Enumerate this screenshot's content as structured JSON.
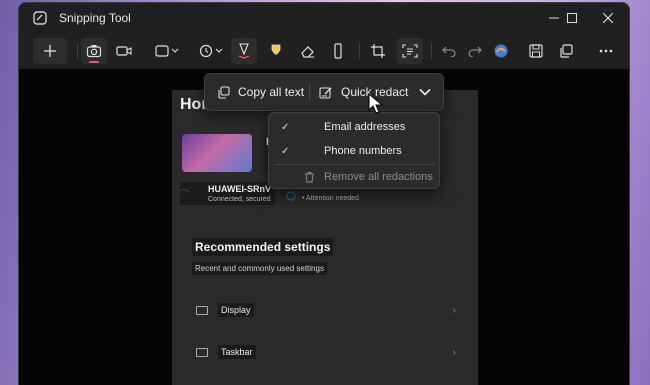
{
  "window": {
    "title": "Snipping Tool"
  },
  "toolbar": {
    "buttons": [
      "new-snip",
      "screenshot-mode",
      "video-mode",
      "snip-shape",
      "delay",
      "ballpoint-pen",
      "highlighter",
      "eraser",
      "ruler",
      "crop",
      "text-actions",
      "undo",
      "redo",
      "paint",
      "save",
      "copy",
      "more"
    ]
  },
  "action_bar": {
    "copy_all_text": "Copy all text",
    "quick_redact": "Quick redact"
  },
  "redact_menu": {
    "items": [
      {
        "label": "Email addresses",
        "checked": true
      },
      {
        "label": "Phone numbers",
        "checked": true
      }
    ],
    "remove_all": "Remove all redactions"
  },
  "screenshot": {
    "title": "Hor",
    "pc_initial": "E",
    "networks": [
      {
        "name": "HUAWEI-SRnV",
        "status": "Connected, secured"
      },
      {
        "name": "",
        "status": "• Attention needed"
      }
    ],
    "recommended_title": "Recommended settings",
    "recommended_sub": "Recent and commonly used settings",
    "settings": [
      {
        "label": "Display"
      },
      {
        "label": "Taskbar"
      }
    ]
  },
  "colors": {
    "accent": "#f2c94c",
    "pen_accent": "#e05a5a",
    "background": "#1c1c1c"
  }
}
